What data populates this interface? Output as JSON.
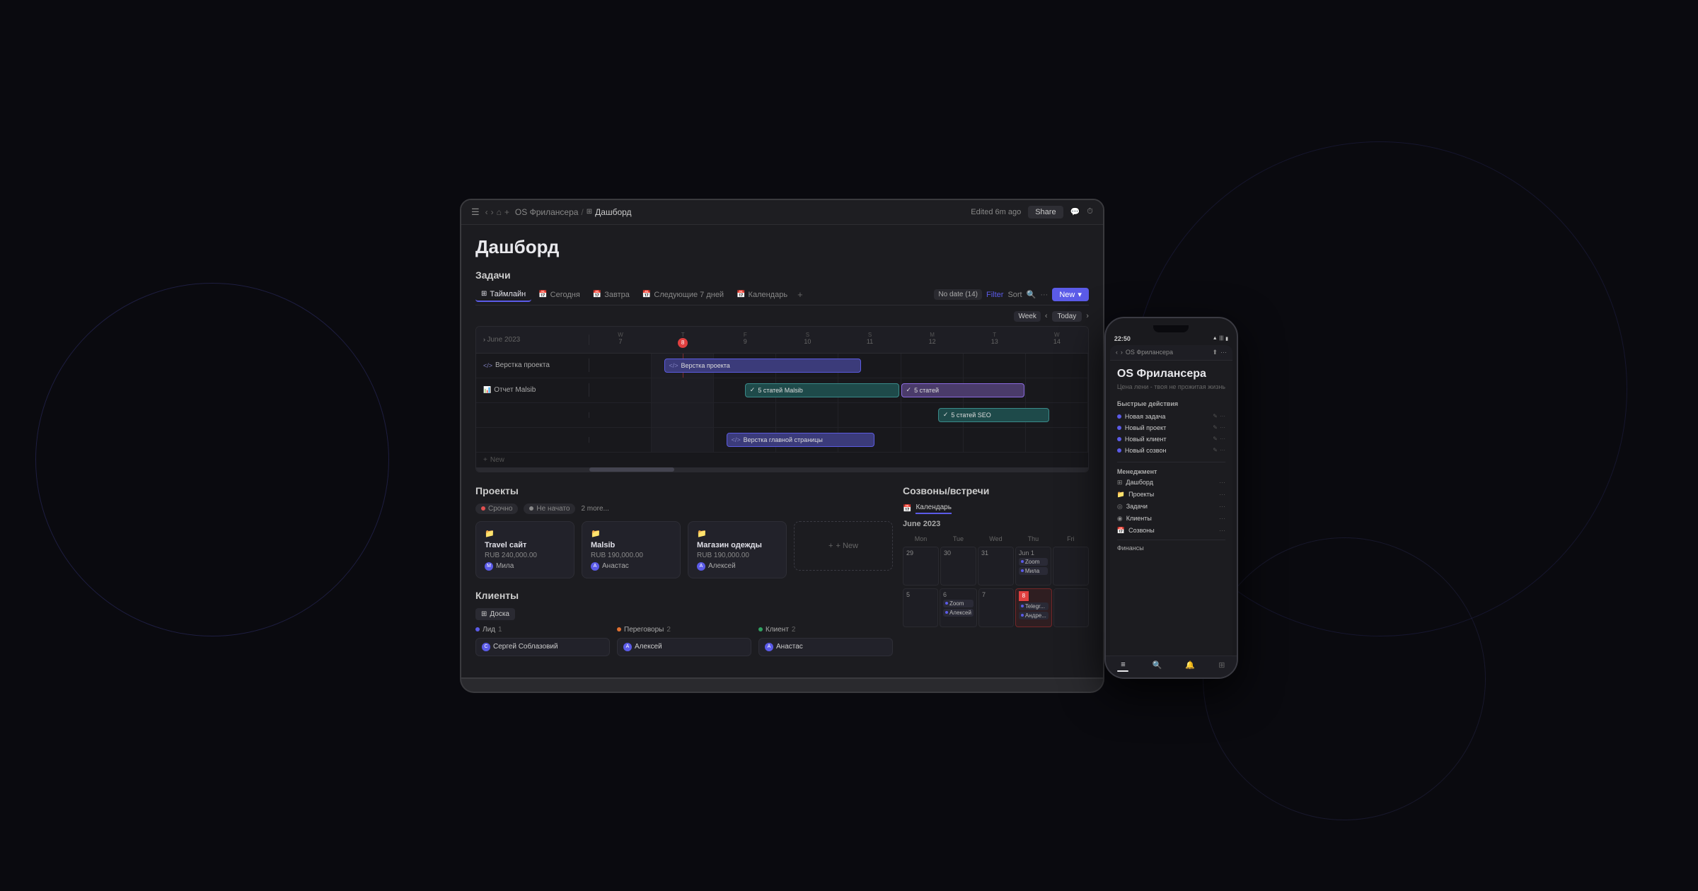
{
  "background": {
    "color": "#0a0a0f"
  },
  "laptop": {
    "chrome": {
      "breadcrumb": "OS Фрилансера",
      "current_page": "Дашборд",
      "edited": "Edited 6m ago",
      "share": "Share"
    },
    "page_title": "Дашборд",
    "tasks": {
      "section_title": "Задачи",
      "tabs": [
        {
          "label": "Таймлайн",
          "icon": "⊞",
          "active": true
        },
        {
          "label": "Сегодня",
          "icon": "📅",
          "active": false
        },
        {
          "label": "Завтра",
          "icon": "📅",
          "active": false
        },
        {
          "label": "Следующие 7 дней",
          "icon": "📅",
          "active": false
        },
        {
          "label": "Календарь",
          "icon": "📅",
          "active": false
        }
      ],
      "no_date": "No date (14)",
      "filter": "Filter",
      "sort": "Sort",
      "new": "New",
      "week": "Week",
      "today": "Today",
      "month": "June 2023",
      "days": [
        {
          "letter": "W",
          "num": "7"
        },
        {
          "letter": "T",
          "num": "8",
          "today": true
        },
        {
          "letter": "F",
          "num": "9"
        },
        {
          "letter": "S",
          "num": "10"
        },
        {
          "letter": "S",
          "num": "11"
        },
        {
          "letter": "M",
          "num": "12"
        },
        {
          "letter": "T",
          "num": "13"
        },
        {
          "letter": "W",
          "num": "14"
        }
      ],
      "rows": [
        {
          "label": "Верстка проекта",
          "icon": "</>"
        },
        {
          "label": "Отчет Malsib",
          "icon": "📊"
        },
        {
          "label": "5 статей Malsib",
          "icon": "✓"
        },
        {
          "label": "5 статей SEO",
          "icon": "✓"
        },
        {
          "label": "Верстка главной страницы",
          "icon": "</>"
        }
      ],
      "add": "+ New"
    },
    "projects": {
      "section_title": "Проекты",
      "filters": [
        "Срочно",
        "Не начато",
        "2 more..."
      ],
      "items": [
        {
          "icon": "📁",
          "name": "Travel сайт",
          "price": "RUB 240,000.00",
          "person": "Мила"
        },
        {
          "icon": "📁",
          "name": "Malsib",
          "price": "RUB 190,000.00",
          "person": "Анастас"
        },
        {
          "icon": "📁",
          "name": "Магазин одежды",
          "price": "RUB 190,000.00",
          "person": "Алексей"
        }
      ],
      "add": "+ New"
    },
    "clients": {
      "section_title": "Клиенты",
      "tabs": [
        "Доска"
      ],
      "columns": [
        {
          "name": "Лид",
          "count": "1",
          "color": "blue"
        },
        {
          "name": "Переговоры",
          "count": "2",
          "color": "orange"
        },
        {
          "name": "Клиент",
          "count": "2",
          "color": "green"
        }
      ],
      "cards": [
        {
          "col": 0,
          "name": "Сергей Соблазовий"
        },
        {
          "col": 1,
          "name": "Алексей"
        },
        {
          "col": 2,
          "name": "Анастас"
        }
      ]
    },
    "meetings": {
      "section_title": "Созвоны/встречи",
      "calendar_tab": "Календарь",
      "month": "June 2023",
      "headers": [
        "Mon",
        "Tue",
        "Wed",
        "Thu",
        "Fri"
      ],
      "weeks": [
        [
          {
            "num": "29",
            "events": []
          },
          {
            "num": "30",
            "events": []
          },
          {
            "num": "31",
            "events": []
          },
          {
            "num": "Jun 1",
            "events": [
              {
                "name": "Zoom",
                "person": "Мила"
              }
            ]
          },
          {
            "num": "",
            "events": []
          }
        ],
        [
          {
            "num": "5",
            "events": []
          },
          {
            "num": "6",
            "events": [
              {
                "name": "Zoom",
                "person": "Алексей"
              }
            ]
          },
          {
            "num": "7",
            "events": []
          },
          {
            "num": "8",
            "events": [
              {
                "name": "Telegr...",
                "person": "Андре..."
              }
            ],
            "today": true
          },
          {
            "num": "",
            "events": []
          }
        ]
      ]
    }
  },
  "phone": {
    "time": "22:50",
    "title": "OS Фрилансера",
    "subtitle": "Цена лени - твоя не прожитая жизнь",
    "breadcrumb": "OS Фрилансера",
    "quick_actions_title": "Быстрые действия",
    "quick_actions": [
      "Новая задача",
      "Новый проект",
      "Новый клиент",
      "Новый созвон"
    ],
    "management_title": "Менеджмент",
    "management_items": [
      {
        "icon": "⊞",
        "label": "Дашборд"
      },
      {
        "icon": "📁",
        "label": "Проекты"
      },
      {
        "icon": "◎",
        "label": "Задачи"
      },
      {
        "icon": "◉",
        "label": "Клиенты"
      },
      {
        "icon": "📅",
        "label": "Созвоны"
      }
    ],
    "finance_title": "Финансы",
    "bottom_tabs": [
      "≡",
      "🔍",
      "🔔",
      "⊞"
    ]
  }
}
